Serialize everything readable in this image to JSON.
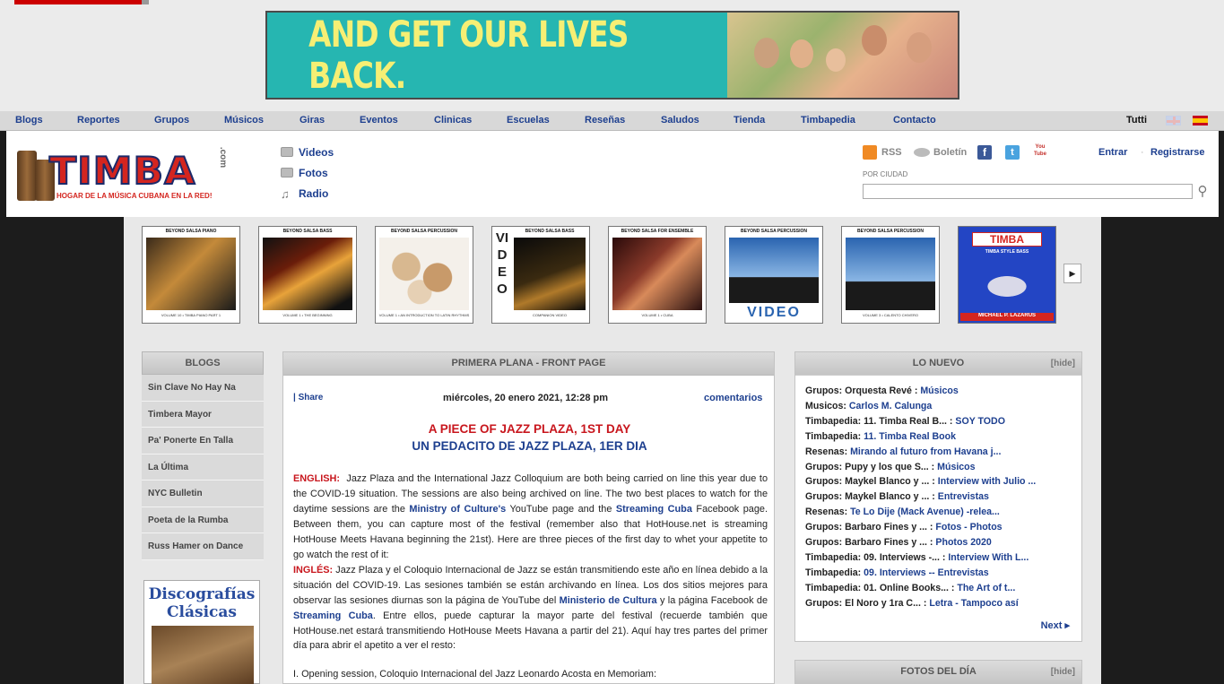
{
  "banner": {
    "text": "AND GET OUR LIVES BACK."
  },
  "nav": {
    "items": [
      "Blogs",
      "Reportes",
      "Grupos",
      "Músicos",
      "Giras",
      "Eventos",
      "Clinicas",
      "Escuelas",
      "Reseñas",
      "Saludos",
      "Tienda",
      "Timbapedia",
      "Contacto"
    ],
    "tutti": "Tutti"
  },
  "logo": {
    "word": "TIMBA",
    "dotcom": ".com",
    "tagline": "HOGAR DE LA MÚSICA CUBANA EN LA RED!"
  },
  "media": [
    "Videos",
    "Fotos",
    "Radio"
  ],
  "social": {
    "rss": "RSS",
    "boletin": "Boletín",
    "facebook": "f",
    "twitter": "t",
    "youtube": "You Tube"
  },
  "search": {
    "label": "POR CIUDAD",
    "value": ""
  },
  "account": {
    "login": "Entrar",
    "sep": "·",
    "register": "Registrarse"
  },
  "carousel": [
    {
      "title": "BEYOND SALSA PIANO",
      "footer": "VOLUME 10 • TIMBA PIANO PART 1"
    },
    {
      "title": "BEYOND SALSA BASS",
      "footer": "VOLUME 1 • THE BEGINNING"
    },
    {
      "title": "BEYOND SALSA PERCUSSION",
      "footer": "VOLUME 1 • AN INTRODUCTION TO LATIN RHYTHMS"
    },
    {
      "title": "BEYOND SALSA BASS",
      "footer": "COMPANION VIDEO",
      "side": "VIDEO"
    },
    {
      "title": "BEYOND SALSA FOR ENSEMBLE",
      "footer": "VOLUME 1 • CUBA"
    },
    {
      "title": "BEYOND SALSA PERCUSSION",
      "footer": "VOLUME 3 • CALENTO CHIVERO",
      "bottom": "VIDEO"
    },
    {
      "title": "BEYOND SALSA PERCUSSION",
      "footer": "VOLUME 3 • CALENTO CHIVERO"
    },
    {
      "title": "TIMBA",
      "sub": "TIMBA STYLE BASS",
      "footer": "MICHAEL P. LAZARUS"
    }
  ],
  "blogs": {
    "heading": "BLOGS",
    "items": [
      "Sin Clave No Hay Na",
      "Timbera Mayor",
      "Pa' Ponerte En Talla",
      "La Última",
      "NYC Bulletin",
      "Poeta de la Rumba",
      "Russ Hamer on Dance"
    ]
  },
  "discografias": {
    "line1": "Discografías",
    "line2": "Clásicas"
  },
  "front": {
    "heading": "PRIMERA PLANA - FRONT PAGE",
    "share": "| Share",
    "date": "miércoles, 20 enero 2021, 12:28 pm",
    "comments": "comentarios",
    "title_en": "A PIECE OF JAZZ PLAZA, 1ST DAY",
    "title_es": "UN PEDACITO DE JAZZ PLAZA, 1ER DIA",
    "en_label": "ENGLISH:",
    "en_p1": "Jazz Plaza and the International Jazz Colloquium are both being carried on line this year due to the COVID-19 situation. The sessions are also being archived on line. The two best places to watch for the daytime sessions are the",
    "en_link1": "Ministry of Culture's",
    "en_p2": "YouTube page and the",
    "en_link2": "Streaming Cuba",
    "en_p3": "Facebook page. Between them, you can capture most of the festival (remember also that HotHouse.net is streaming HotHouse Meets Havana beginning the 21st). Here are three pieces of the first day to whet your appetite to go watch the rest of it:",
    "es_label": "INGLÉS:",
    "es_p1": "Jazz Plaza y el Coloquio Internacional de Jazz se están transmitiendo este año en línea debido a la situación del COVID-19. Las sesiones también se están archivando en línea. Los dos sitios mejores para observar las sesiones diurnas son la página de YouTube del",
    "es_link1": "Ministerio de Cultura",
    "es_p2": "y la página Facebook de",
    "es_link2": "Streaming Cuba",
    "es_p3": ". Entre ellos, puede capturar la mayor parte del festival (recuerde también que HotHouse.net estará transmitiendo HotHouse Meets Havana a partir del 21). Aquí hay tres partes del primer día para abrir el apetito a ver el resto:",
    "opening": "I. Opening session, Coloquio Internacional del Jazz Leonardo Acosta en Memoriam:"
  },
  "nuevo": {
    "heading": "LO NUEVO",
    "hide": "[hide]",
    "items": [
      {
        "text": "Grupos: Orquesta Revé : ",
        "link": "Músicos"
      },
      {
        "text": "Musicos: ",
        "link": "Carlos M. Calunga"
      },
      {
        "text": "Timbapedia: 11. Timba Real B... : ",
        "link": "SOY TODO"
      },
      {
        "text": "Timbapedia: ",
        "link": "11. Timba Real Book"
      },
      {
        "text": "Resenas: ",
        "link": "Mirando al futuro from Havana j..."
      },
      {
        "text": "Grupos: Pupy y los que S... : ",
        "link": "Músicos"
      },
      {
        "text": "Grupos: Maykel Blanco y ... : ",
        "link": "Interview with Julio ..."
      },
      {
        "text": "Grupos: Maykel Blanco y ... : ",
        "link": "Entrevistas"
      },
      {
        "text": "Resenas: ",
        "link": "Te Lo Dije (Mack Avenue) -relea..."
      },
      {
        "text": "Grupos: Barbaro Fines y ... : ",
        "link": "Fotos - Photos"
      },
      {
        "text": "Grupos: Barbaro Fines y ... : ",
        "link": "Photos 2020"
      },
      {
        "text": "Timbapedia: 09. Interviews -... : ",
        "link": "Interview With L..."
      },
      {
        "text": "Timbapedia: ",
        "link": "09. Interviews -- Entrevistas"
      },
      {
        "text": "Timbapedia: 01. Online Books... : ",
        "link": "The Art of t..."
      },
      {
        "text": "Grupos: El Noro y 1ra C... : ",
        "link": "Letra - Tampoco así"
      }
    ],
    "next": "Next ▸"
  },
  "fotos": {
    "heading": "FOTOS DEL DÍA",
    "hide": "[hide]"
  },
  "colors": {
    "link": "#1d3f8f",
    "red": "#c8161d",
    "banner": "#26b6b1",
    "banner_text": "#f6ef74"
  }
}
